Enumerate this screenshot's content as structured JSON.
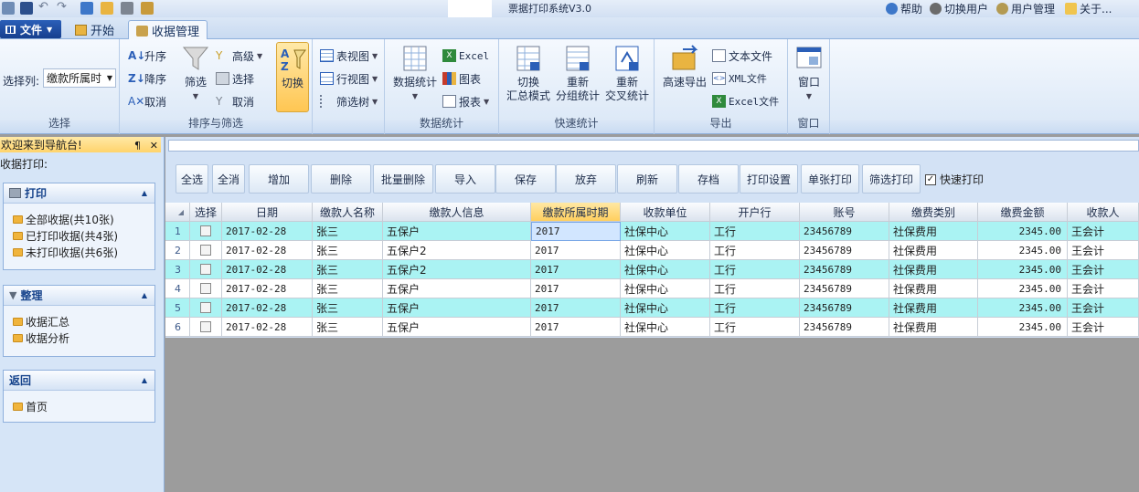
{
  "titlebar": {
    "app_title": "票据打印系统V3.0",
    "links": [
      "帮助",
      "切换用户",
      "用户管理",
      "关于..."
    ]
  },
  "tabs": {
    "file": "文件",
    "items": [
      "开始",
      "收据管理"
    ],
    "active": "收据管理"
  },
  "ribbon": {
    "select_group": {
      "label": "选择列:",
      "combo_value": "缴款所属时",
      "group_label": "选择"
    },
    "sort_filter": {
      "asc": "升序",
      "desc": "降序",
      "cancel1": "取消",
      "filter": "筛选",
      "advanced": "高级",
      "select": "选择",
      "cancel2": "取消",
      "switch": "切换",
      "group_label": "排序与筛选"
    },
    "view": {
      "table_view": "表视图",
      "row_view": "行视图",
      "filter_tree": "筛选树"
    },
    "data_stats": {
      "stats": "数据统计",
      "excel": "Excel",
      "chart": "图表",
      "report": "报表",
      "group_label": "数据统计"
    },
    "quick_stats": {
      "btn1": [
        "切换",
        "汇总模式"
      ],
      "btn2": [
        "重新",
        "分组统计"
      ],
      "btn3": [
        "重新",
        "交叉统计"
      ],
      "group_label": "快速统计"
    },
    "export": {
      "fast": "高速导出",
      "text": "文本文件",
      "xml": "XML文件",
      "excel": "Excel文件",
      "group_label": "导出"
    },
    "window": {
      "btn": "窗口",
      "group_label": "窗口"
    }
  },
  "nav": {
    "header": "欢迎来到导航台!",
    "pin": "¶",
    "close": "✕",
    "subtitle": "收据打印:",
    "panels": [
      {
        "title": "打印",
        "items": [
          "全部收据(共10张)",
          "已打印收据(共4张)",
          "未打印收据(共6张)"
        ]
      },
      {
        "title": "整理",
        "items": [
          "收据汇总",
          "收据分析"
        ]
      },
      {
        "title": "返回",
        "items": [
          "首页"
        ]
      }
    ]
  },
  "toolbar": {
    "buttons": [
      "全选",
      "全消",
      "增加",
      "删除",
      "批量删除",
      "导入",
      "保存",
      "放弃",
      "刷新",
      "存档",
      "打印设置",
      "单张打印",
      "筛选打印"
    ],
    "quick_print": "快速打印",
    "quick_print_checked": true
  },
  "grid": {
    "columns": [
      "选择",
      "日期",
      "缴款人名称",
      "缴款人信息",
      "缴款所属时期",
      "收款单位",
      "开户行",
      "账号",
      "缴费类别",
      "缴费金额",
      "收款人"
    ],
    "rows": [
      {
        "num": "1",
        "date": "2017-02-28",
        "payer": "张三",
        "info": "五保户",
        "period": "2017",
        "unit": "社保中心",
        "bank": "工行",
        "account": "23456789",
        "type": "社保费用",
        "amount": "2345.00",
        "receiver": "王会计"
      },
      {
        "num": "2",
        "date": "2017-02-28",
        "payer": "张三",
        "info": "五保户2",
        "period": "2017",
        "unit": "社保中心",
        "bank": "工行",
        "account": "23456789",
        "type": "社保费用",
        "amount": "2345.00",
        "receiver": "王会计"
      },
      {
        "num": "3",
        "date": "2017-02-28",
        "payer": "张三",
        "info": "五保户2",
        "period": "2017",
        "unit": "社保中心",
        "bank": "工行",
        "account": "23456789",
        "type": "社保费用",
        "amount": "2345.00",
        "receiver": "王会计"
      },
      {
        "num": "4",
        "date": "2017-02-28",
        "payer": "张三",
        "info": "五保户",
        "period": "2017",
        "unit": "社保中心",
        "bank": "工行",
        "account": "23456789",
        "type": "社保费用",
        "amount": "2345.00",
        "receiver": "王会计"
      },
      {
        "num": "5",
        "date": "2017-02-28",
        "payer": "张三",
        "info": "五保户",
        "period": "2017",
        "unit": "社保中心",
        "bank": "工行",
        "account": "23456789",
        "type": "社保费用",
        "amount": "2345.00",
        "receiver": "王会计"
      },
      {
        "num": "6",
        "date": "2017-02-28",
        "payer": "张三",
        "info": "五保户",
        "period": "2017",
        "unit": "社保中心",
        "bank": "工行",
        "account": "23456789",
        "type": "社保费用",
        "amount": "2345.00",
        "receiver": "王会计"
      }
    ]
  },
  "colors": {
    "accent": "#ffcf5e",
    "row_alt": "#aaf3f3",
    "nav_bg": "#d6e5f7",
    "header_blue": "#15428b"
  }
}
